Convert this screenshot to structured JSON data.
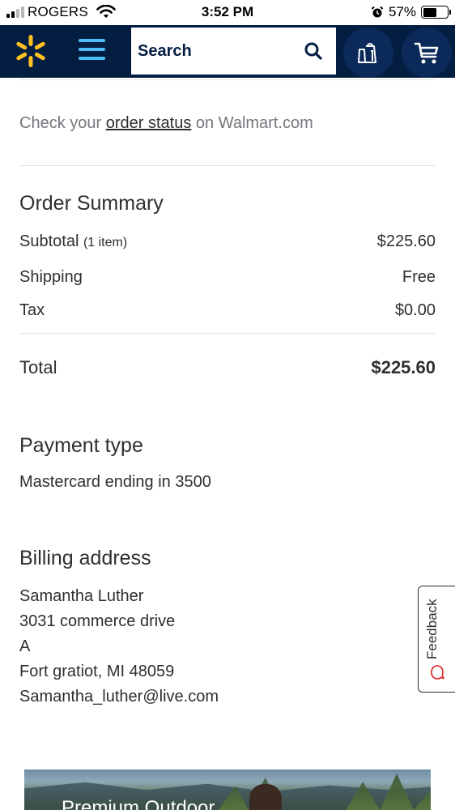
{
  "status_bar": {
    "carrier": "ROGERS",
    "time": "3:52 PM",
    "battery_percent": "57%",
    "battery_level": 0.57
  },
  "header": {
    "logo_icon": "walmart-spark-icon",
    "menu_icon": "hamburger-menu-icon",
    "search_placeholder": "Search",
    "search_icon": "search-icon",
    "lists_icon": "grocery-bag-icon",
    "cart_icon": "cart-icon",
    "brand_color": "#041e42",
    "accent_color": "#ffc220",
    "menu_color": "#4dbdf5"
  },
  "order_status": {
    "prefix": "Check your",
    "link": "order status",
    "suffix": "on Walmart.com"
  },
  "order_summary": {
    "title": "Order Summary",
    "subtotal_label": "Subtotal",
    "subtotal_count": "(1 item)",
    "subtotal_value": "$225.60",
    "shipping_label": "Shipping",
    "shipping_value": "Free",
    "tax_label": "Tax",
    "tax_value": "$0.00",
    "total_label": "Total",
    "total_value": "$225.60"
  },
  "payment": {
    "title": "Payment type",
    "method": "Mastercard ending in 3500"
  },
  "billing": {
    "title": "Billing address",
    "name": "Samantha Luther",
    "street": "3031 commerce drive",
    "line2": "A",
    "city_state_zip": "Fort gratiot, MI 48059",
    "email": "Samantha_luther@live.com"
  },
  "feedback": {
    "label": "Feedback",
    "icon": "chat-bubble-icon"
  },
  "banner": {
    "title": "Premium Outdoor"
  }
}
